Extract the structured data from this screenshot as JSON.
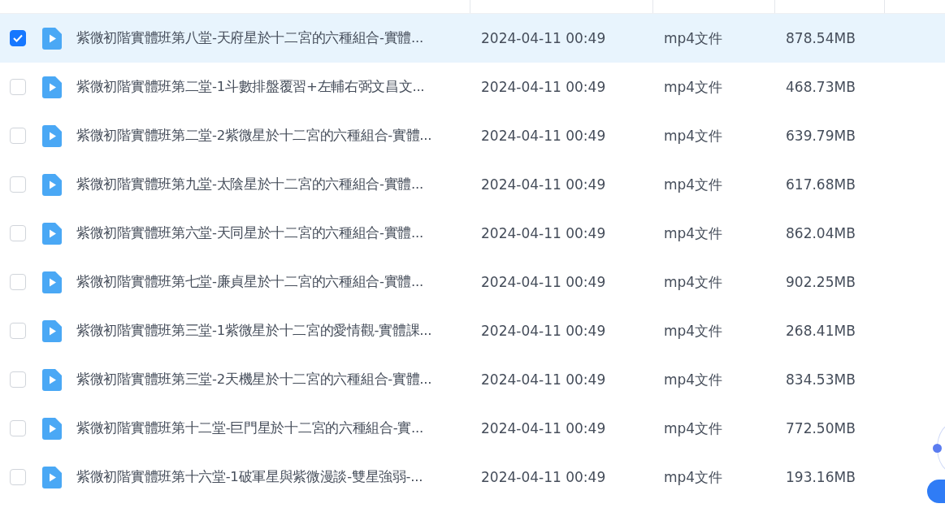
{
  "rows": [
    {
      "name": "紫微初階實體班第八堂-天府星於十二宮的六種組合-實體...",
      "modified": "2024-04-11 00:49",
      "type": "mp4文件",
      "size": "878.54MB",
      "selected": true
    },
    {
      "name": "紫微初階實體班第二堂-1斗數排盤覆習+左輔右弼文昌文...",
      "modified": "2024-04-11 00:49",
      "type": "mp4文件",
      "size": "468.73MB",
      "selected": false
    },
    {
      "name": "紫微初階實體班第二堂-2紫微星於十二宮的六種組合-實體...",
      "modified": "2024-04-11 00:49",
      "type": "mp4文件",
      "size": "639.79MB",
      "selected": false
    },
    {
      "name": "紫微初階實體班第九堂-太陰星於十二宮的六種組合-實體...",
      "modified": "2024-04-11 00:49",
      "type": "mp4文件",
      "size": "617.68MB",
      "selected": false
    },
    {
      "name": "紫微初階實體班第六堂-天同星於十二宮的六種組合-實體...",
      "modified": "2024-04-11 00:49",
      "type": "mp4文件",
      "size": "862.04MB",
      "selected": false
    },
    {
      "name": "紫微初階實體班第七堂-廉貞星於十二宮的六種組合-實體...",
      "modified": "2024-04-11 00:49",
      "type": "mp4文件",
      "size": "902.25MB",
      "selected": false
    },
    {
      "name": "紫微初階實體班第三堂-1紫微星於十二宮的愛情觀-實體課...",
      "modified": "2024-04-11 00:49",
      "type": "mp4文件",
      "size": "268.41MB",
      "selected": false
    },
    {
      "name": "紫微初階實體班第三堂-2天機星於十二宮的六種組合-實體...",
      "modified": "2024-04-11 00:49",
      "type": "mp4文件",
      "size": "834.53MB",
      "selected": false
    },
    {
      "name": "紫微初階實體班第十二堂-巨門星於十二宮的六種組合-實...",
      "modified": "2024-04-11 00:49",
      "type": "mp4文件",
      "size": "772.50MB",
      "selected": false
    },
    {
      "name": "紫微初階實體班第十六堂-1破軍星與紫微漫談-雙星強弱-...",
      "modified": "2024-04-11 00:49",
      "type": "mp4文件",
      "size": "193.16MB",
      "selected": false
    }
  ]
}
